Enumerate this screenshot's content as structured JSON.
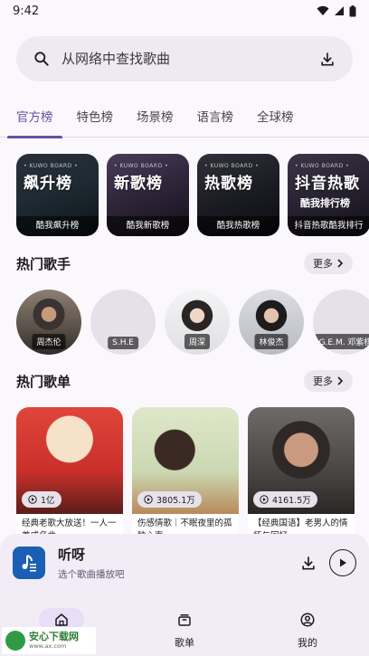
{
  "status_bar": {
    "time": "9:42",
    "icons": [
      "wifi-icon",
      "signal-icon",
      "battery-icon"
    ]
  },
  "search": {
    "placeholder": "从网络中查找歌曲",
    "icon": "search-icon",
    "action_icon": "download-icon"
  },
  "tabs": [
    {
      "label": "官方榜",
      "active": true
    },
    {
      "label": "特色榜",
      "active": false
    },
    {
      "label": "场景榜",
      "active": false
    },
    {
      "label": "语言榜",
      "active": false
    },
    {
      "label": "全球榜",
      "active": false
    }
  ],
  "boards": [
    {
      "tag": "• KUWO BOARD •",
      "title": "飙升榜",
      "subtitle": "",
      "caption": "酷我飙升榜"
    },
    {
      "tag": "• KUWO BOARD •",
      "title": "新歌榜",
      "subtitle": "",
      "caption": "酷我新歌榜"
    },
    {
      "tag": "• KUWO BOARD •",
      "title": "热歌榜",
      "subtitle": "",
      "caption": "酷我热歌榜"
    },
    {
      "tag": "• KUWO BOARD •",
      "title": "抖音热歌",
      "subtitle": "酷我排行榜",
      "caption": "抖音热歌酷我排行"
    }
  ],
  "hot_singers": {
    "title": "热门歌手",
    "more_label": "更多",
    "items": [
      {
        "name": "周杰伦"
      },
      {
        "name": "S.H.E"
      },
      {
        "name": "周深"
      },
      {
        "name": "林俊杰"
      },
      {
        "name": "G.E.M. 邓紫棋"
      }
    ]
  },
  "hot_playlists": {
    "title": "热门歌单",
    "more_label": "更多",
    "items": [
      {
        "plays": "1亿",
        "desc": "经典老歌大放送！一人一首成名曲"
      },
      {
        "plays": "3805.1万",
        "desc": "伤感情歌｜不眠夜里的孤独心声"
      },
      {
        "plays": "4161.5万",
        "desc": "【经典国语】老男人的情怀与回忆"
      }
    ]
  },
  "player": {
    "title": "听呀",
    "subtitle": "选个歌曲播放吧"
  },
  "bottom_nav": [
    {
      "label": "",
      "icon": "home-icon",
      "active": true
    },
    {
      "label": "歌单",
      "icon": "playlist-icon",
      "active": false
    },
    {
      "label": "我的",
      "icon": "profile-icon",
      "active": false
    }
  ],
  "watermark": {
    "main": "安心下载网",
    "sub": "www.ax.com"
  },
  "colors": {
    "accent": "#6750a4",
    "background": "#fbf8fd"
  }
}
